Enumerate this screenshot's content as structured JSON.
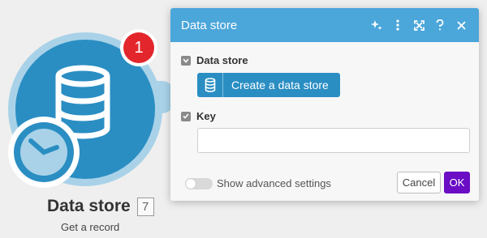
{
  "module": {
    "title": "Data store",
    "id_badge": "7",
    "subtitle": "Get a record",
    "notification_count": "1",
    "icon": "database-icon",
    "secondary_icon": "clock-icon",
    "color": "#2a8ec3"
  },
  "dialog": {
    "title": "Data store",
    "header_icons": [
      "ai-sparkle-icon",
      "more-vertical-icon",
      "expand-icon",
      "help-icon",
      "close-icon"
    ],
    "header_color": "#4ba6da",
    "sections": {
      "data_store_label": "Data store",
      "create_button_label": "Create a data store",
      "key_label": "Key",
      "key_value": ""
    },
    "footer": {
      "advanced_label": "Show advanced settings",
      "advanced_enabled": false,
      "cancel_label": "Cancel",
      "ok_label": "OK",
      "ok_color": "#6a0dc5"
    }
  }
}
